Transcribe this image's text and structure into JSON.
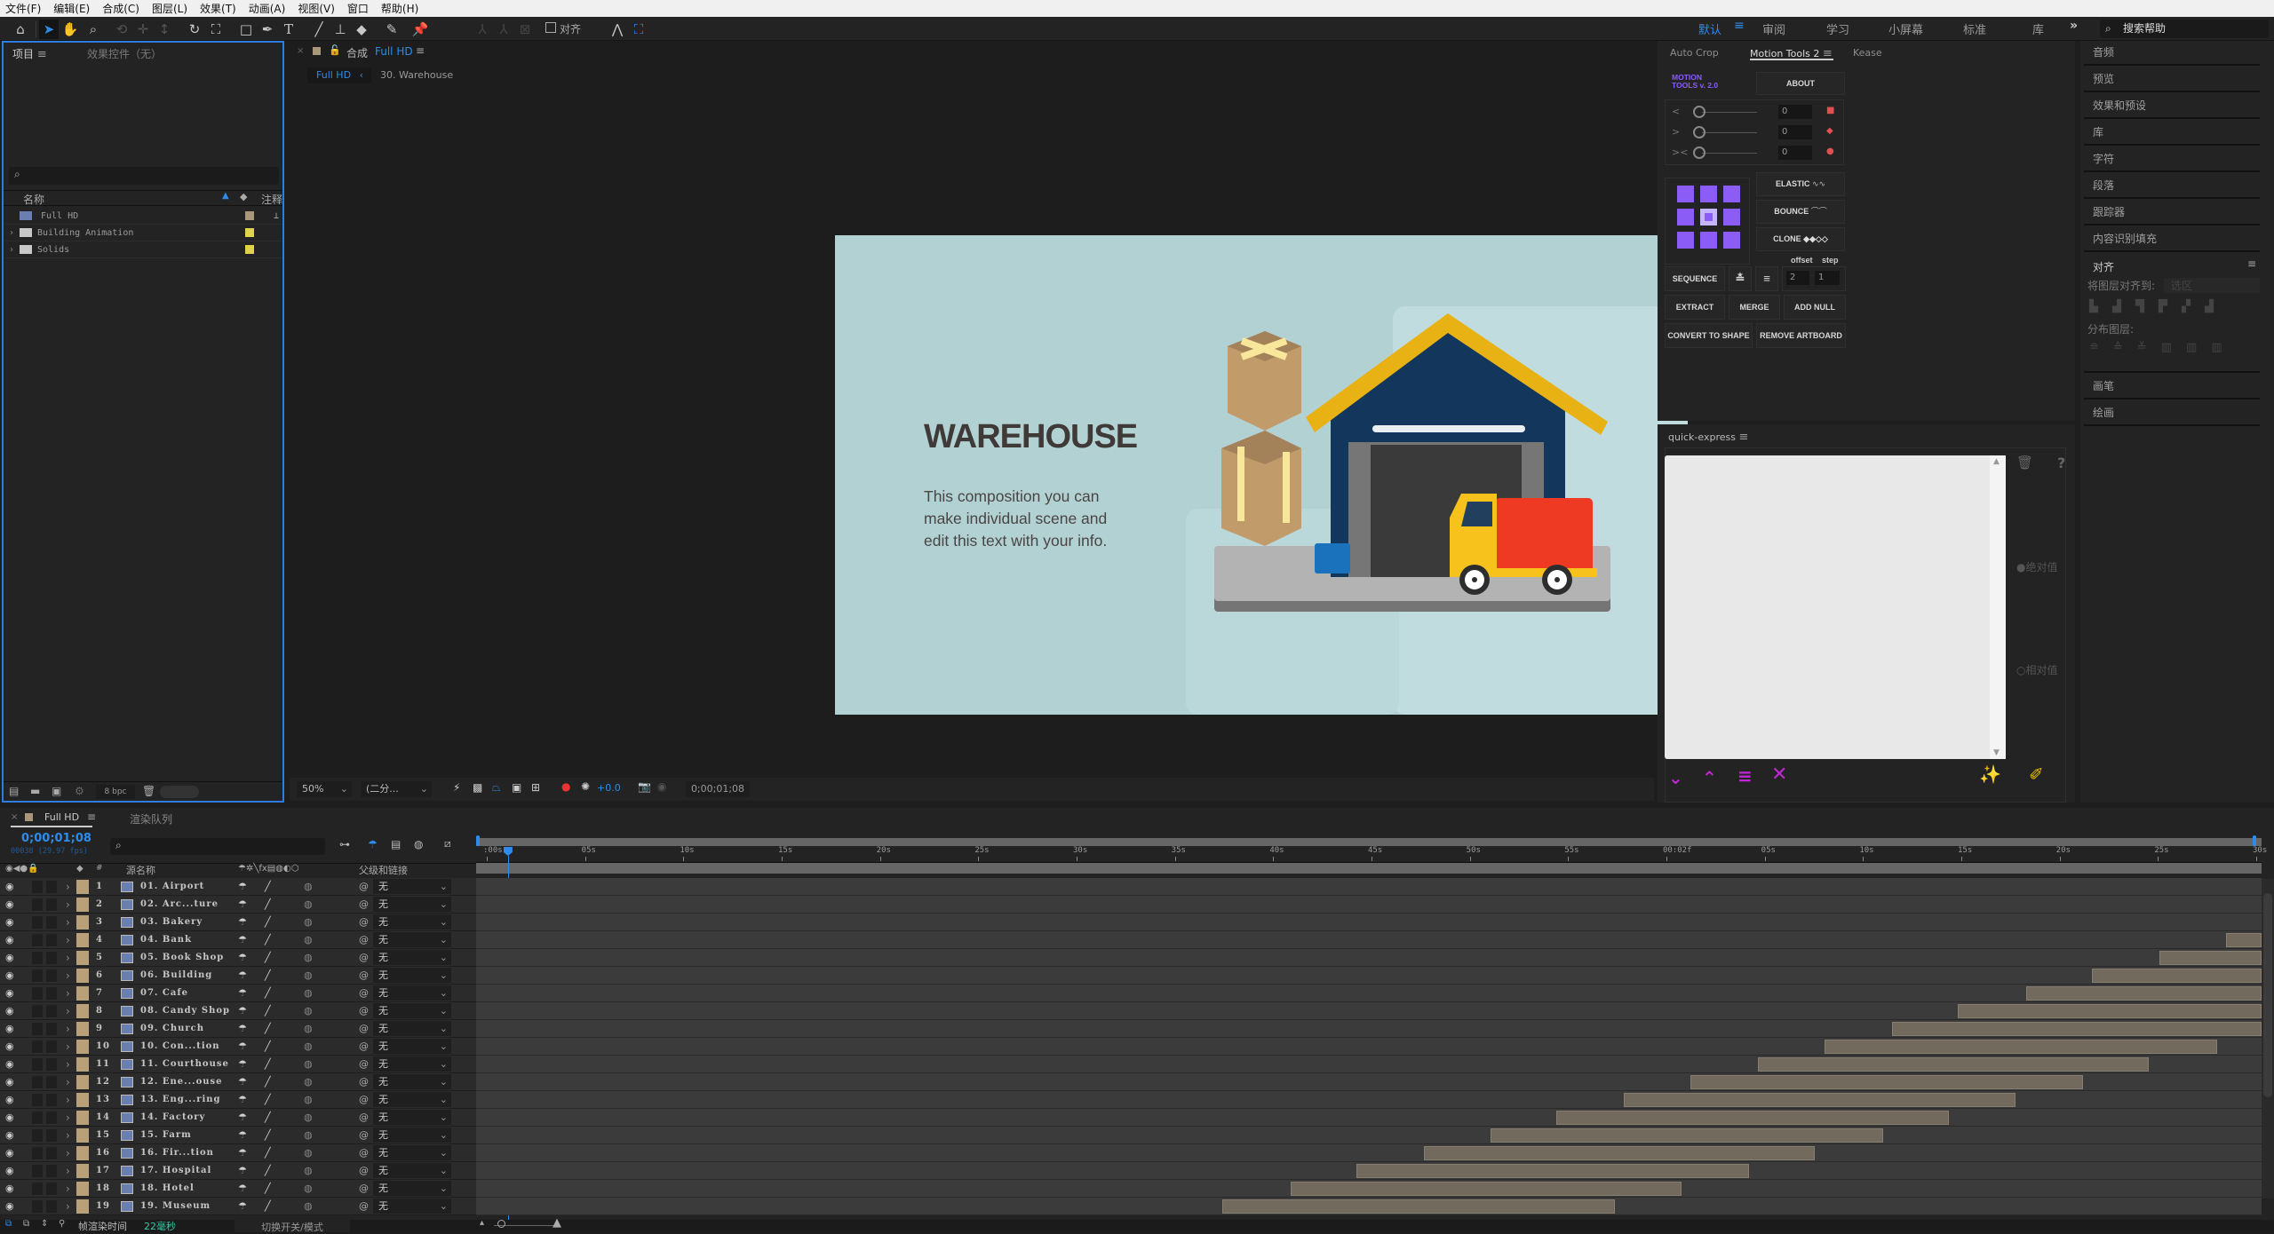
{
  "menu": [
    "文件(F)",
    "编辑(E)",
    "合成(C)",
    "图层(L)",
    "效果(T)",
    "动画(A)",
    "视图(V)",
    "窗口",
    "帮助(H)"
  ],
  "toolbar": {
    "snap_label": "对齐",
    "workspaces": [
      {
        "label": "默认",
        "active": true
      },
      {
        "label": "审阅",
        "active": false
      },
      {
        "label": "学习",
        "active": false
      },
      {
        "label": "小屏幕",
        "active": false
      },
      {
        "label": "标准",
        "active": false
      },
      {
        "label": "库",
        "active": false
      }
    ],
    "more": "»",
    "search_placeholder": "搜索帮助"
  },
  "project": {
    "tab_project": "项目",
    "tab_effects": "效果控件（无）",
    "search_placeholder": "",
    "col_name": "名称",
    "col_comment": "注释",
    "items": [
      {
        "name": "Full HD",
        "type": "composition",
        "color": "#a8977a"
      },
      {
        "name": "Building Animation",
        "type": "folder",
        "color": "#e0d24c"
      },
      {
        "name": "Solids",
        "type": "folder",
        "color": "#e0d24c"
      }
    ],
    "bpc": "8 bpc"
  },
  "comp": {
    "tab_prefix": "合成",
    "tab_name": "Full HD",
    "breadcrumb_active": "Full HD",
    "breadcrumb_child": "30. Warehouse",
    "zoom": "50%",
    "resolution": "(二分...",
    "exposure": "+0.0",
    "timecode": "0;00;01;08",
    "scene_title": "WAREHOUSE",
    "scene_body": [
      "This composition you can",
      "make individual scene and",
      "edit this text with your info."
    ],
    "colors": {
      "bg": "#b2d1d3",
      "roof": "#e8b214",
      "house": "#13365c",
      "truck_cab": "#f7c21c",
      "truck_box": "#ee3a22",
      "box": "#c29b6b"
    }
  },
  "motion_tools": {
    "tabs": [
      "Auto Crop",
      "Motion Tools 2",
      "Kease"
    ],
    "active_tab": "Motion Tools 2",
    "logo": [
      "MOTION",
      "TOOLS v. 2.0"
    ],
    "about": "ABOUT",
    "sliders": [
      {
        "icon": "<",
        "value": "0"
      },
      {
        "icon": ">",
        "value": "0"
      },
      {
        "icon": "><",
        "value": "0"
      }
    ],
    "elastic": "ELASTIC",
    "bounce": "BOUNCE",
    "clone": "CLONE",
    "offset_label": "offset",
    "step_label": "step",
    "sequence": "SEQUENCE",
    "offset_value": "2",
    "step_value": "1",
    "extract": "EXTRACT",
    "merge": "MERGE",
    "add_null": "ADD NULL",
    "convert": "CONVERT TO SHAPE",
    "remove_artboard": "REMOVE ARTBOARD",
    "accent": "#8b5cf6"
  },
  "quick_express": {
    "title": "quick-express",
    "absolute": "绝对值",
    "relative": "相对值"
  },
  "right_panels": {
    "items": [
      "音频",
      "预览",
      "效果和预设",
      "库",
      "字符",
      "段落",
      "跟踪器",
      "内容识别填充"
    ],
    "align_title": "对齐",
    "align_to_label": "将图层对齐到:",
    "align_to_value": "选区",
    "distribute_label": "分布图层:",
    "bottom_items": [
      "画笔",
      "绘画"
    ]
  },
  "timeline": {
    "tab_comp": "Full HD",
    "tab_render": "渲染队列",
    "timecode": "0;00;01;08",
    "frame_info": "00038 (29.97 fps)",
    "col_num": "#",
    "col_source": "源名称",
    "col_parent": "父级和链接",
    "ruler": [
      ":00s",
      "05s",
      "10s",
      "15s",
      "20s",
      "25s",
      "30s",
      "35s",
      "40s",
      "45s",
      "50s",
      "55s",
      "00:02f",
      "05s",
      "10s",
      "15s",
      "20s",
      "25s",
      "30s"
    ],
    "playhead_fraction": 0.012,
    "render_time_label": "帧渲染时间",
    "render_time_value": "22毫秒",
    "toggle_label": "切换开关/模式",
    "parent_value": "无",
    "layers": [
      {
        "num": "1",
        "name": "01. Airport",
        "start": null,
        "end": null
      },
      {
        "num": "2",
        "name": "02. Arc...ture",
        "start": null,
        "end": null
      },
      {
        "num": "3",
        "name": "03. Bakery",
        "start": null,
        "end": null
      },
      {
        "num": "4",
        "name": "04. Bank",
        "start": 0.98,
        "end": 1.0
      },
      {
        "num": "5",
        "name": "05. Book Shop",
        "start": 0.943,
        "end": 1.0
      },
      {
        "num": "6",
        "name": "06. Building",
        "start": 0.905,
        "end": 1.0
      },
      {
        "num": "7",
        "name": "07. Cafe",
        "start": 0.868,
        "end": 1.0
      },
      {
        "num": "8",
        "name": "08. Candy Shop",
        "start": 0.83,
        "end": 1.0
      },
      {
        "num": "9",
        "name": "09. Church",
        "start": 0.793,
        "end": 1.0
      },
      {
        "num": "10",
        "name": "10. Con...tion",
        "start": 0.755,
        "end": 0.975
      },
      {
        "num": "11",
        "name": "11. Courthouse",
        "start": 0.718,
        "end": 0.937
      },
      {
        "num": "12",
        "name": "12. Ene...ouse",
        "start": 0.68,
        "end": 0.9
      },
      {
        "num": "13",
        "name": "13. Eng...ring",
        "start": 0.643,
        "end": 0.862
      },
      {
        "num": "14",
        "name": "14. Factory",
        "start": 0.605,
        "end": 0.825
      },
      {
        "num": "15",
        "name": "15. Farm",
        "start": 0.568,
        "end": 0.788
      },
      {
        "num": "16",
        "name": "16. Fir...tion",
        "start": 0.531,
        "end": 0.75
      },
      {
        "num": "17",
        "name": "17. Hospital",
        "start": 0.493,
        "end": 0.713
      },
      {
        "num": "18",
        "name": "18. Hotel",
        "start": 0.456,
        "end": 0.675
      },
      {
        "num": "19",
        "name": "19. Museum",
        "start": 0.418,
        "end": 0.638
      }
    ]
  }
}
